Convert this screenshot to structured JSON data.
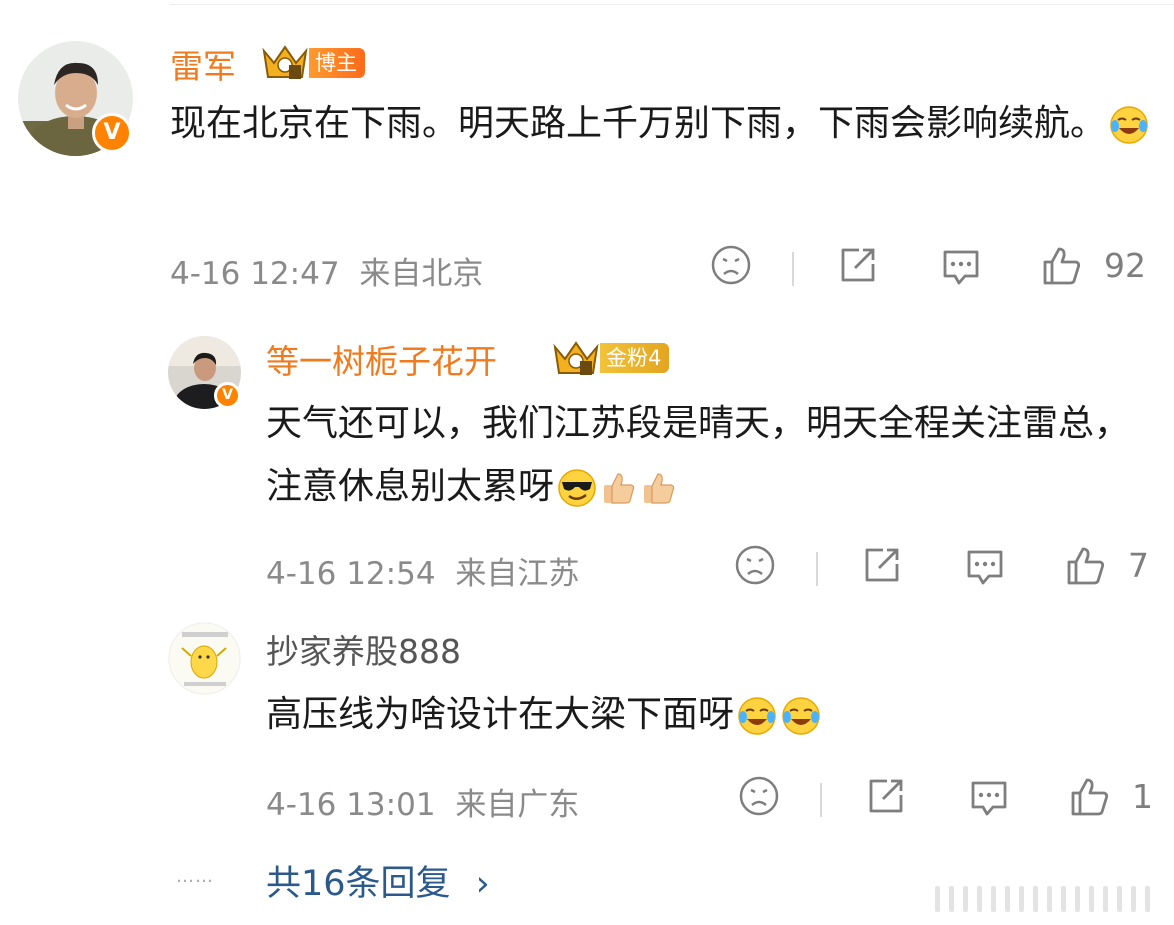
{
  "comments": [
    {
      "username": "雷军",
      "badge_label": "博主",
      "text": "现在北京在下雨。明天路上千万别下雨，下雨会影响续航。",
      "time": "4-16 12:47",
      "location": "来自北京",
      "likes": "92"
    },
    {
      "username": "等一树栀子花开",
      "badge_label": "金粉4",
      "text": "天气还可以，我们江苏段是晴天，明天全程关注雷总，注意休息别太累呀",
      "time": "4-16 12:54",
      "location": "来自江苏",
      "likes": "7"
    },
    {
      "username": "抄家养股888",
      "text": "高压线为啥设计在大梁下面呀",
      "time": "4-16 13:01",
      "location": "来自广东",
      "likes": "1"
    }
  ],
  "more_replies": {
    "label": "共16条回复",
    "dots": "……"
  },
  "colors": {
    "username": "#f07a1e",
    "link": "#2b5a8a",
    "meta": "#8a8a8a",
    "verified": "#ff8200"
  }
}
